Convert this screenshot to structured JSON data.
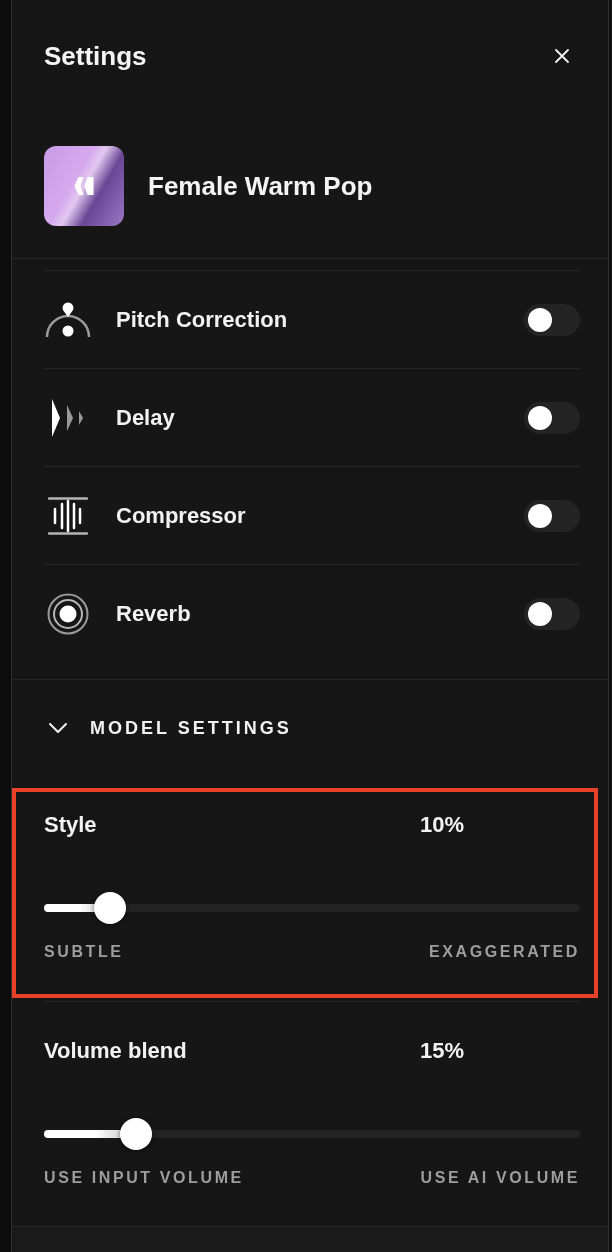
{
  "panel": {
    "title": "Settings"
  },
  "voice": {
    "name": "Female Warm Pop"
  },
  "effects": [
    {
      "label": "Pitch Correction",
      "on": false
    },
    {
      "label": "Delay",
      "on": false
    },
    {
      "label": "Compressor",
      "on": false
    },
    {
      "label": "Reverb",
      "on": false
    }
  ],
  "model_settings": {
    "title": "MODEL SETTINGS",
    "expanded": true,
    "sliders": [
      {
        "label": "Style",
        "value": "10%",
        "level": 0.1,
        "min_label": "SUBTLE",
        "max_label": "EXAGGERATED",
        "highlighted": true
      },
      {
        "label": "Volume blend",
        "value": "15%",
        "level": 0.15,
        "min_label": "USE INPUT VOLUME",
        "max_label": "USE AI VOLUME",
        "highlighted": false
      }
    ]
  }
}
